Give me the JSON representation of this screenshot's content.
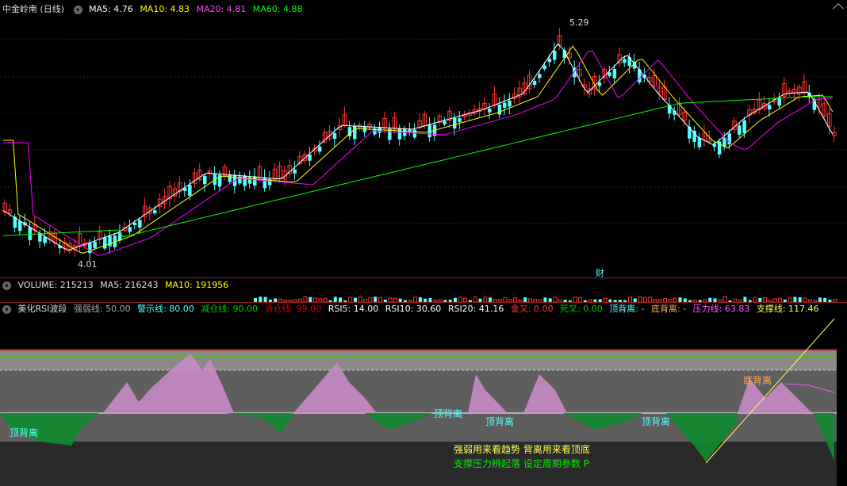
{
  "price_panel": {
    "title": "中金岭南 (日线)",
    "ma5_label": "MA5: 4.76",
    "ma10_label": "MA10: 4.83",
    "ma20_label": "MA20: 4.81",
    "ma60_label": "MA60: 4.88",
    "high_marker": "5.29",
    "low_marker": "4.01",
    "event_marker": "财",
    "colors": {
      "ma5": "#ffffff",
      "ma10": "#ffff00",
      "ma20": "#ff00ff",
      "ma60": "#00ff00",
      "up": "#ff3333",
      "down": "#54ffff"
    }
  },
  "volume_panel": {
    "volume_label": "VOLUME: 215213",
    "ma5_label": "MA5: 216243",
    "ma10_label": "MA10: 191956"
  },
  "indicator_panel": {
    "name": "美化RSI波段",
    "params": [
      {
        "text": "强弱线: 50.00",
        "color": "#aaaaaa"
      },
      {
        "text": "警示线: 80.00",
        "color": "#54ffff"
      },
      {
        "text": "减仓线: 90.00",
        "color": "#00cc00"
      },
      {
        "text": "清仓线: 99.00",
        "color": "#cc0000"
      },
      {
        "text": "RSI5: 14.00",
        "color": "#ffffff"
      },
      {
        "text": "RSI10: 30.60",
        "color": "#ffffff"
      },
      {
        "text": "RSI20: 41.16",
        "color": "#ffffff"
      },
      {
        "text": "金叉: 0.00",
        "color": "#ff3333"
      },
      {
        "text": "死叉: 0.00",
        "color": "#00cc00"
      },
      {
        "text": "顶背离: -",
        "color": "#54ffff"
      },
      {
        "text": "底背离: -",
        "color": "#ffaa55"
      },
      {
        "text": "压力线: 63.83",
        "color": "#ff55ff"
      },
      {
        "text": "支撑线: 117.46",
        "color": "#ffff55"
      }
    ],
    "top_divergence_label": "顶背离",
    "bottom_divergence_label": "底背离",
    "note_line1": "强弱用来看趋势 背离用来看顶底",
    "note_line2": "支撑压力辨起落 设定周期参数 P"
  }
}
